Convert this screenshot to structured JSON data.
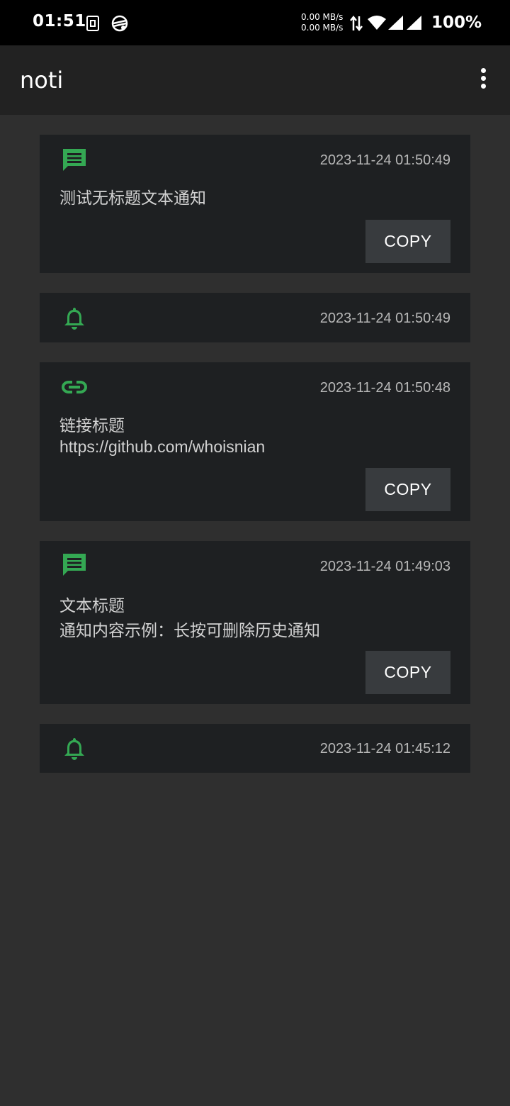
{
  "status_bar": {
    "time": "01:51",
    "net_up": "0.00 MB/s",
    "net_down": "0.00 MB/s",
    "battery": "100%"
  },
  "app_bar": {
    "title": "noti",
    "menu_icon": "more-vert-icon"
  },
  "colors": {
    "accent": "#34a853",
    "card_bg": "#1e2022",
    "page_bg": "#2f2f2f",
    "appbar_bg": "#222222",
    "button_bg": "#383b3e"
  },
  "notifications": [
    {
      "icon": "message-icon",
      "time": "2023-11-24 01:50:49",
      "lines": [
        "测试无标题文本通知"
      ],
      "copy_label": "COPY"
    },
    {
      "icon": "bell-icon",
      "time": "2023-11-24 01:50:49",
      "lines": []
    },
    {
      "icon": "link-icon",
      "time": "2023-11-24 01:50:48",
      "lines": [
        "链接标题",
        "https://github.com/whoisnian"
      ],
      "copy_label": "COPY"
    },
    {
      "icon": "message-icon",
      "time": "2023-11-24 01:49:03",
      "lines": [
        "文本标题",
        "通知内容示例：长按可删除历史通知"
      ],
      "copy_label": "COPY"
    },
    {
      "icon": "bell-icon",
      "time": "2023-11-24 01:45:12",
      "lines": []
    }
  ]
}
